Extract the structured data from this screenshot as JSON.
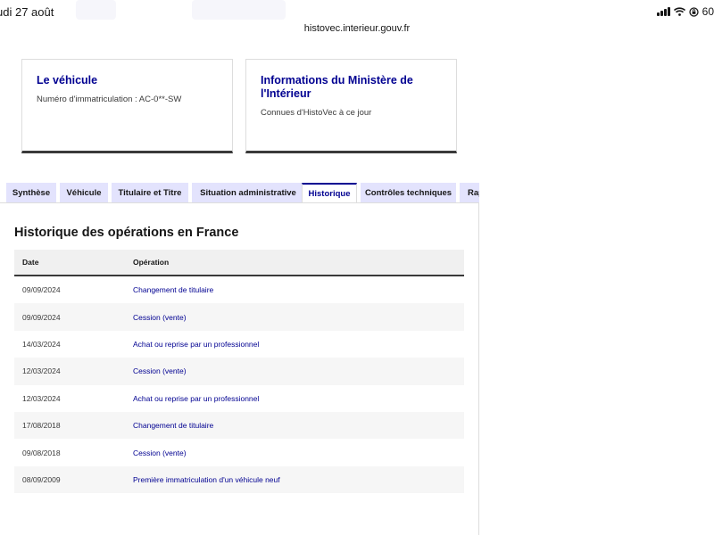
{
  "status_bar": {
    "date": "udi 27 août",
    "battery": "60"
  },
  "browser": {
    "url": "histovec.interieur.gouv.fr"
  },
  "cards": {
    "vehicle": {
      "title": "Le véhicule",
      "description": "Numéro d'immatriculation : AC-0**-SW"
    },
    "ministry": {
      "title": "Informations du Ministère de l'Intérieur",
      "description": "Connues d'HistoVec à ce jour"
    }
  },
  "tabs": [
    {
      "label": "Synthèse",
      "active": false
    },
    {
      "label": "Véhicule",
      "active": false
    },
    {
      "label": "Titulaire et Titre",
      "active": false
    },
    {
      "label": "Situation administrative",
      "active": false
    },
    {
      "label": "Historique",
      "active": true
    },
    {
      "label": "Contrôles techniques",
      "active": false
    },
    {
      "label": "Rap",
      "active": false
    }
  ],
  "history": {
    "title": "Historique des opérations en France",
    "columns": {
      "date": "Date",
      "operation": "Opération"
    },
    "rows": [
      {
        "date": "09/09/2024",
        "operation": "Changement de titulaire"
      },
      {
        "date": "09/09/2024",
        "operation": "Cession (vente)"
      },
      {
        "date": "14/03/2024",
        "operation": "Achat ou reprise par un professionnel"
      },
      {
        "date": "12/03/2024",
        "operation": "Cession (vente)"
      },
      {
        "date": "12/03/2024",
        "operation": "Achat ou reprise par un professionnel"
      },
      {
        "date": "17/08/2018",
        "operation": "Changement de titulaire"
      },
      {
        "date": "09/08/2018",
        "operation": "Cession (vente)"
      },
      {
        "date": "08/09/2009",
        "operation": "Première immatriculation d'un véhicule neuf"
      }
    ]
  },
  "colors": {
    "accent": "#000091",
    "tab_bg": "#e3e3fd",
    "row_alt": "#f6f6f6"
  }
}
